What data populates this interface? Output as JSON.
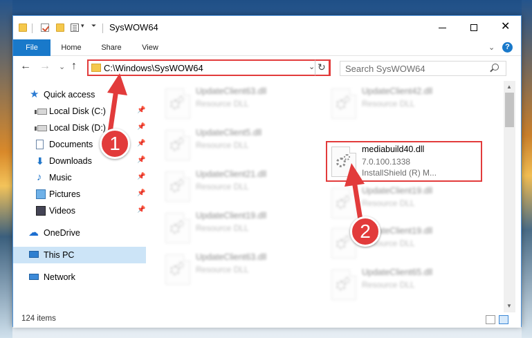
{
  "window": {
    "title": "SysWOW64",
    "qa_dropdown": "▾",
    "qa_more": "⏷",
    "close": "✕"
  },
  "ribbon": {
    "tabs": [
      "File",
      "Home",
      "Share",
      "View"
    ],
    "collapse": "⌄",
    "help": "?"
  },
  "nav": {
    "back": "←",
    "forward": "→",
    "recent": "⌄",
    "up": "↑",
    "address": "C:\\Windows\\SysWOW64",
    "address_dropdown": "⌄",
    "refresh": "↻",
    "search_placeholder": "Search SysWOW64"
  },
  "sidebar": {
    "pin": "📌",
    "items": [
      {
        "label": "Quick access",
        "icon": "star-icon"
      },
      {
        "label": "Local Disk (C:)",
        "icon": "drive-icon"
      },
      {
        "label": "Local Disk (D:)",
        "icon": "drive-icon"
      },
      {
        "label": "Documents",
        "icon": "document-icon"
      },
      {
        "label": "Downloads",
        "icon": "download-icon"
      },
      {
        "label": "Music",
        "icon": "music-icon"
      },
      {
        "label": "Pictures",
        "icon": "pictures-icon"
      },
      {
        "label": "Videos",
        "icon": "videos-icon"
      },
      {
        "label": "OneDrive",
        "icon": "cloud-icon"
      },
      {
        "label": "This PC",
        "icon": "computer-icon"
      },
      {
        "label": "Network",
        "icon": "network-icon"
      }
    ]
  },
  "files": [
    {
      "name": "UpdateClient63.dll",
      "type": "Resource DLL"
    },
    {
      "name": "UpdateClient42.dll",
      "type": "Resource DLL"
    },
    {
      "name": "UpdateClient5.dll",
      "type": "Resource DLL"
    },
    {
      "name": "mediabuild40.dll",
      "version": "7.0.100.1338",
      "company": "InstallShield (R) M..."
    },
    {
      "name": "UpdateClient21.dll",
      "type": "Resource DLL"
    },
    {
      "name": "UpdateClient19.dll",
      "type": "Resource DLL"
    },
    {
      "name": "UpdateClient19.dll",
      "type": "Resource DLL"
    },
    {
      "name": "UpdateClient19.dll",
      "type": "Resource DLL"
    },
    {
      "name": "UpdateClient63.dll",
      "type": "Resource DLL"
    },
    {
      "name": "UpdateClient65.dll",
      "type": "Resource DLL"
    }
  ],
  "status": {
    "item_count": "124 items"
  },
  "annotations": {
    "step1": "1",
    "step2": "2",
    "color": "#e23b3b"
  }
}
